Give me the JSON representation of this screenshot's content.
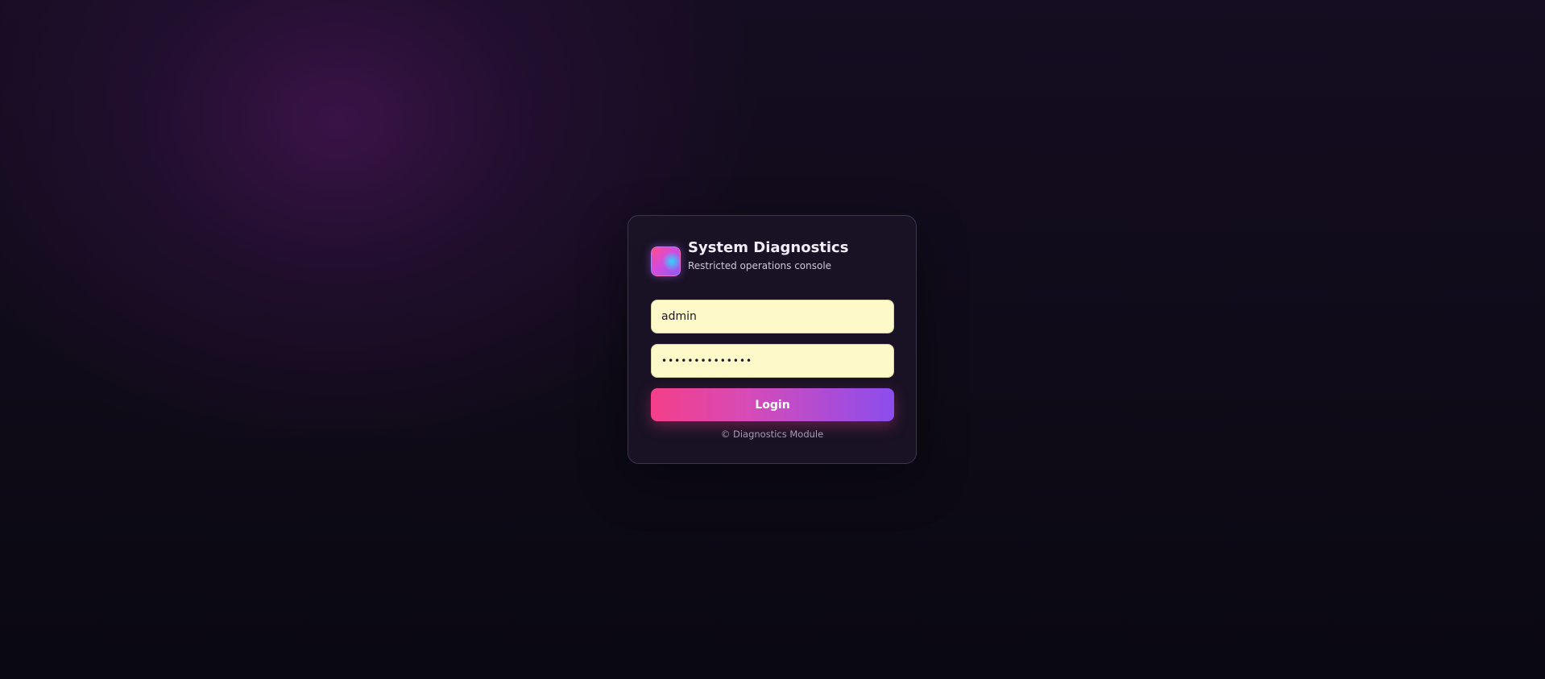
{
  "app": {
    "title": "System Diagnostics",
    "subtitle": "Restricted operations console"
  },
  "form": {
    "username_value": "admin",
    "password_value": "••••••••••••••",
    "login_label": "Login"
  },
  "footer": {
    "text": "© Diagnostics Module"
  },
  "colors": {
    "accent_start": "#f43f8a",
    "accent_end": "#8b4dee",
    "input_background": "#fdf9c8",
    "card_background": "#1a1426"
  },
  "icons": {
    "logo": "gradient-square-logo"
  }
}
